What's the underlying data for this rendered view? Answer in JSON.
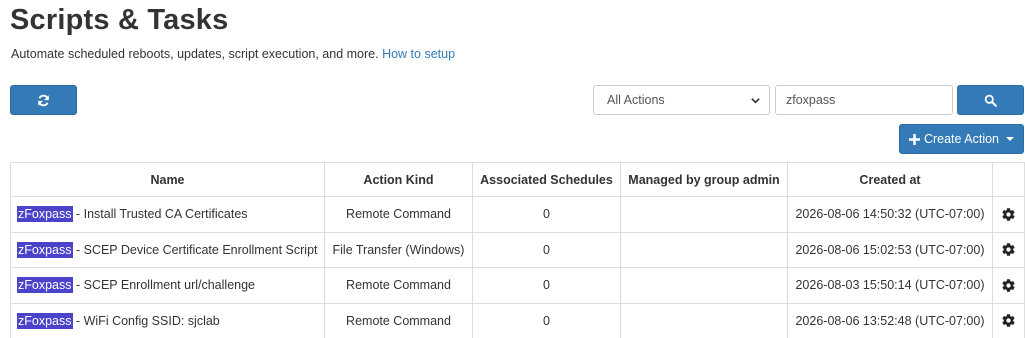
{
  "header": {
    "title": "Scripts & Tasks",
    "subtitle": "Automate scheduled reboots, updates, script execution, and more.",
    "setup_link": "How to setup"
  },
  "toolbar": {
    "refresh_icon": "refresh-icon",
    "filter_selected": "All Actions",
    "search_value": "zfoxpass",
    "search_icon": "search-icon",
    "create_label": "Create Action"
  },
  "table": {
    "columns": [
      "Name",
      "Action Kind",
      "Associated Schedules",
      "Managed by group admin",
      "Created at",
      ""
    ],
    "rows": [
      {
        "highlight": "zFoxpass",
        "name": " - Install Trusted CA Certificates",
        "kind": "Remote Command",
        "schedules": "0",
        "managed": "",
        "created": "2026-08-06 14:50:32 (UTC-07:00)"
      },
      {
        "highlight": "zFoxpass",
        "name": " - SCEP Device Certificate Enrollment Script",
        "kind": "File Transfer (Windows)",
        "schedules": "0",
        "managed": "",
        "created": "2026-08-06 15:02:53 (UTC-07:00)"
      },
      {
        "highlight": "zFoxpass",
        "name": " - SCEP Enrollment url/challenge",
        "kind": "Remote Command",
        "schedules": "0",
        "managed": "",
        "created": "2026-08-03 15:50:14 (UTC-07:00)"
      },
      {
        "highlight": "zFoxpass",
        "name": " - WiFi Config SSID: sjclab",
        "kind": "Remote Command",
        "schedules": "0",
        "managed": "",
        "created": "2026-08-06 13:52:48 (UTC-07:00)"
      }
    ]
  }
}
